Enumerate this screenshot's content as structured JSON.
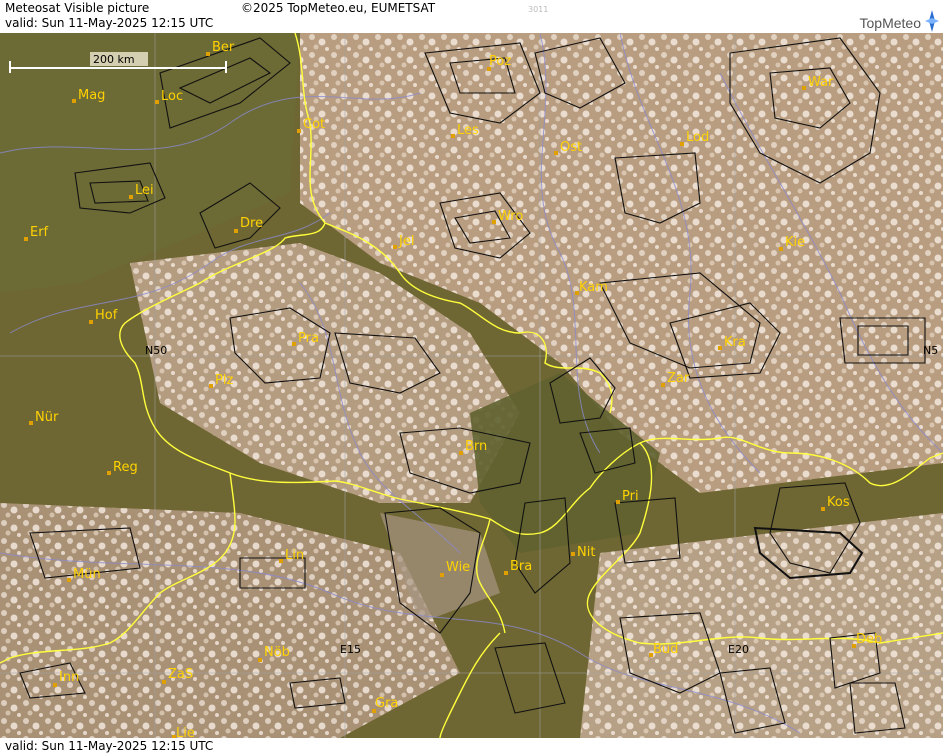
{
  "header": {
    "title": "Meteosat Visible picture",
    "valid": "valid:  Sun  11-May-2025  12:15 UTC",
    "copyright": "©2025 TopMeteo.eu, EUMETSAT",
    "code": "3011",
    "logo": "TopMeteo"
  },
  "footer": {
    "valid": "valid:  Sun  11-May-2025  12:15 UTC"
  },
  "scale": {
    "label": "200 km"
  },
  "grid_labels": {
    "n50_left": "N50",
    "n50_right": "N5",
    "e15": "E15",
    "e20": "E20"
  },
  "cities": [
    {
      "name": "Ber"
    },
    {
      "name": "Poz"
    },
    {
      "name": "War"
    },
    {
      "name": "Mag"
    },
    {
      "name": "Loc"
    },
    {
      "name": "Cot"
    },
    {
      "name": "Les"
    },
    {
      "name": "Ost"
    },
    {
      "name": "Lod"
    },
    {
      "name": "Lei"
    },
    {
      "name": "Dre"
    },
    {
      "name": "Wro"
    },
    {
      "name": "Erf"
    },
    {
      "name": "Jel"
    },
    {
      "name": "Kie"
    },
    {
      "name": "Kam"
    },
    {
      "name": "Hof"
    },
    {
      "name": "Pra"
    },
    {
      "name": "Kra"
    },
    {
      "name": "Plz"
    },
    {
      "name": "Zar"
    },
    {
      "name": "Nür"
    },
    {
      "name": "Brn"
    },
    {
      "name": "Reg"
    },
    {
      "name": "Pri"
    },
    {
      "name": "Kos"
    },
    {
      "name": "Lin"
    },
    {
      "name": "Nit"
    },
    {
      "name": "Wie"
    },
    {
      "name": "Bra"
    },
    {
      "name": "Mün"
    },
    {
      "name": "Nöb"
    },
    {
      "name": "Bud"
    },
    {
      "name": "Deb"
    },
    {
      "name": "Inn"
    },
    {
      "name": "ZaS"
    },
    {
      "name": "Gra"
    },
    {
      "name": "Lie"
    }
  ]
}
